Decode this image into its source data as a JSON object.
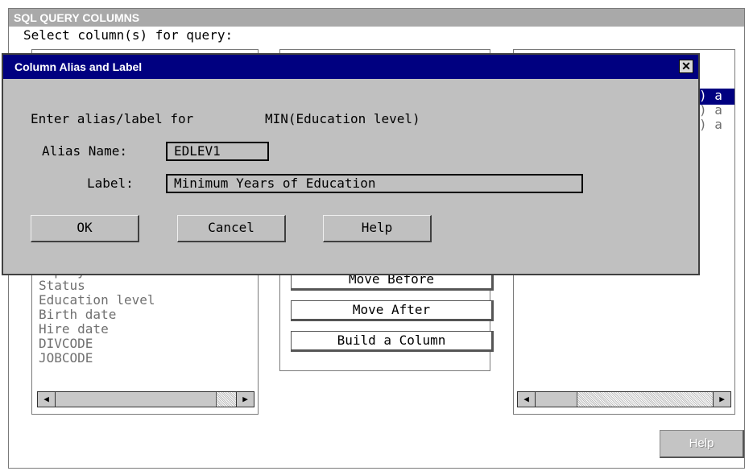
{
  "main_window": {
    "title": "SQL QUERY COLUMNS",
    "prompt": "Select column(s) for query:"
  },
  "available_columns": {
    "items": [
      "Employee Gender",
      "Status",
      "Education level",
      "Birth date",
      "Hire date",
      "DIVCODE",
      "JOBCODE"
    ]
  },
  "selected_columns": {
    "visible_fragments": [
      ") a",
      ") a",
      ") a"
    ]
  },
  "actions": {
    "move_before": "Move Before",
    "move_after": "Move After",
    "build_column": "Build a Column"
  },
  "help_label": "Help",
  "dialog": {
    "title": "Column Alias and Label",
    "close_glyph": "✕",
    "prompt": "Enter alias/label for",
    "target": "MIN(Education level)",
    "alias_label": "Alias Name:",
    "alias_value": "EDLEV1",
    "label_label": "Label:",
    "label_value": "Minimum Years of Education",
    "ok": "OK",
    "cancel": "Cancel",
    "help": "Help"
  },
  "colors": {
    "dialog_title_bg": "#000080",
    "dialog_bg": "#c0c0c0",
    "main_title_bg": "#a9a9a9",
    "list_text": "#707070"
  }
}
